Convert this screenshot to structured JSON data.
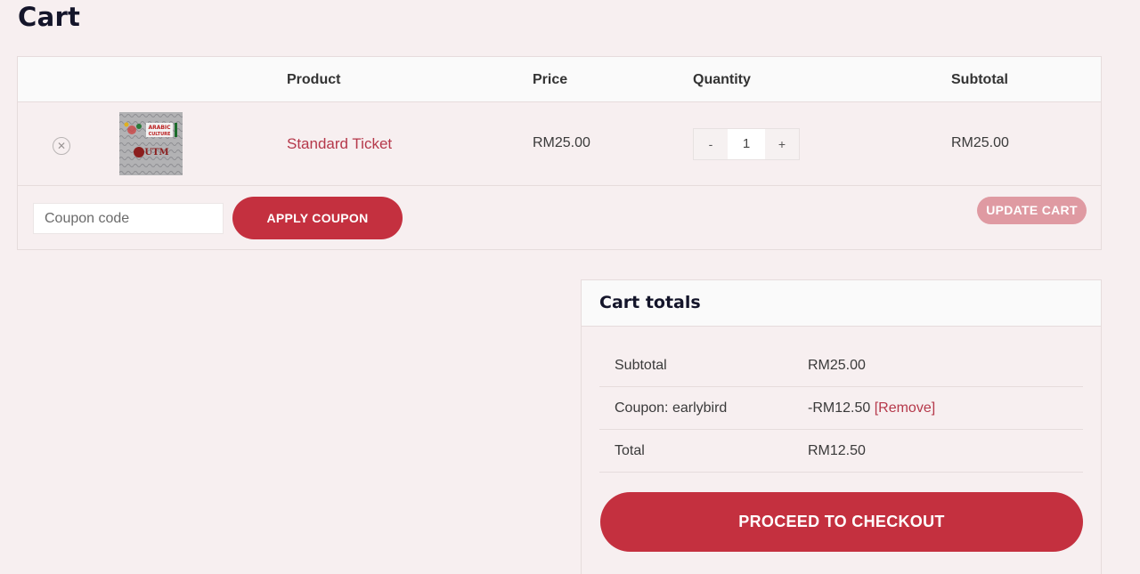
{
  "page": {
    "title": "Cart"
  },
  "cart_table": {
    "headers": {
      "product": "Product",
      "price": "Price",
      "quantity": "Quantity",
      "subtotal": "Subtotal"
    },
    "items": [
      {
        "remove_icon": "close-circle-icon",
        "thumbnail_texts": {
          "line1": "ARABIC",
          "line2": "CULTURE",
          "line3": "UTM"
        },
        "name": "Standard Ticket",
        "price": "RM25.00",
        "quantity": {
          "minus": "-",
          "value": "1",
          "plus": "+"
        },
        "subtotal": "RM25.00"
      }
    ],
    "coupon": {
      "placeholder": "Coupon code",
      "apply_label": "APPLY COUPON"
    },
    "update_label": "UPDATE CART"
  },
  "cart_totals": {
    "title": "Cart totals",
    "rows": [
      {
        "label": "Subtotal",
        "value": "RM25.00"
      },
      {
        "label": "Coupon: earlybird",
        "value": "-RM12.50",
        "link": "[Remove]"
      },
      {
        "label": "Total",
        "value": "RM12.50"
      }
    ],
    "checkout_label": "PROCEED TO CHECKOUT"
  },
  "colors": {
    "accent": "#c4303f",
    "accent_disabled": "#df9aa2",
    "link": "#b5384a",
    "background": "#f7eff0"
  }
}
